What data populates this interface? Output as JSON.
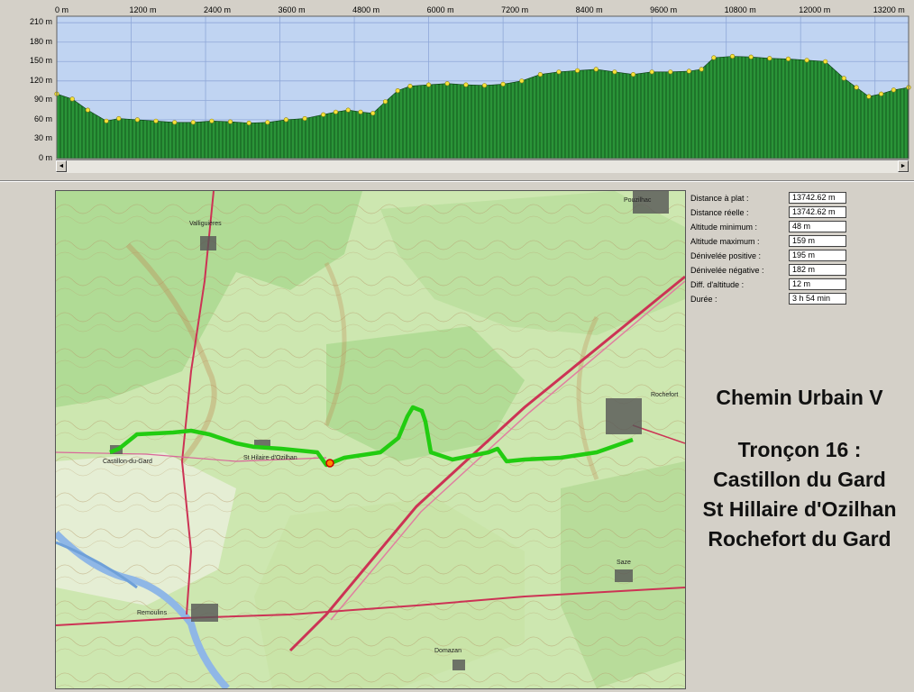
{
  "profile": {
    "x_ticks": [
      "0 m",
      "1200 m",
      "2400 m",
      "3600 m",
      "4800 m",
      "6000 m",
      "7200 m",
      "8400 m",
      "9600 m",
      "10800 m",
      "12000 m",
      "13200 m"
    ],
    "y_ticks": [
      "210 m",
      "180 m",
      "150 m",
      "120 m",
      "90 m",
      "60 m",
      "30 m",
      "0 m"
    ]
  },
  "chart_data": {
    "type": "area",
    "xlabel": "",
    "ylabel": "",
    "xlim": [
      0,
      13742
    ],
    "ylim": [
      0,
      220
    ],
    "x": [
      0,
      250,
      500,
      800,
      1000,
      1300,
      1600,
      1900,
      2200,
      2500,
      2800,
      3100,
      3400,
      3700,
      4000,
      4300,
      4500,
      4700,
      4900,
      5100,
      5300,
      5500,
      5700,
      6000,
      6300,
      6600,
      6900,
      7200,
      7500,
      7800,
      8100,
      8400,
      8700,
      9000,
      9300,
      9600,
      9900,
      10200,
      10400,
      10600,
      10900,
      11200,
      11500,
      11800,
      12100,
      12400,
      12700,
      12900,
      13100,
      13300,
      13500,
      13742
    ],
    "y": [
      100,
      92,
      75,
      58,
      62,
      60,
      58,
      56,
      56,
      58,
      57,
      55,
      56,
      60,
      62,
      68,
      72,
      75,
      72,
      70,
      88,
      105,
      112,
      114,
      116,
      114,
      113,
      115,
      120,
      130,
      134,
      136,
      138,
      134,
      130,
      134,
      134,
      135,
      138,
      156,
      158,
      157,
      155,
      154,
      152,
      150,
      124,
      110,
      96,
      100,
      106,
      110
    ]
  },
  "stats": [
    {
      "label": "Distance à plat :",
      "value": "13742.62 m"
    },
    {
      "label": "Distance réelle :",
      "value": "13742.62 m"
    },
    {
      "label": "Altitude minimum :",
      "value": "48 m"
    },
    {
      "label": "Altitude maximum :",
      "value": "159 m"
    },
    {
      "label": "Dénivelée positive :",
      "value": "195 m"
    },
    {
      "label": "Dénivelée négative :",
      "value": "182 m"
    },
    {
      "label": "Diff. d'altitude :",
      "value": "12 m"
    },
    {
      "label": "Durée :",
      "value": "3 h 54 min"
    }
  ],
  "title": {
    "line1": "Chemin Urbain V",
    "line2": "Tronçon 16 :",
    "line3": "Castillon du Gard",
    "line4": "St Hillaire d'Ozilhan",
    "line5": "Rochefort du Gard"
  },
  "map": {
    "labels": [
      "Castillon-du-Gard",
      "St Hilaire-d'Ozilhan",
      "Remoulins",
      "Rochefort",
      "Valliguières",
      "Pouzilhac",
      "Saze",
      "Domazan"
    ]
  },
  "colors": {
    "sky": "#c0d4f2",
    "terrain": "#2a9438",
    "route": "#22cc11",
    "map_bg": "#cfe6b5"
  },
  "icons": {
    "scroll_left": "arrow-left-icon",
    "scroll_right": "arrow-right-icon"
  }
}
